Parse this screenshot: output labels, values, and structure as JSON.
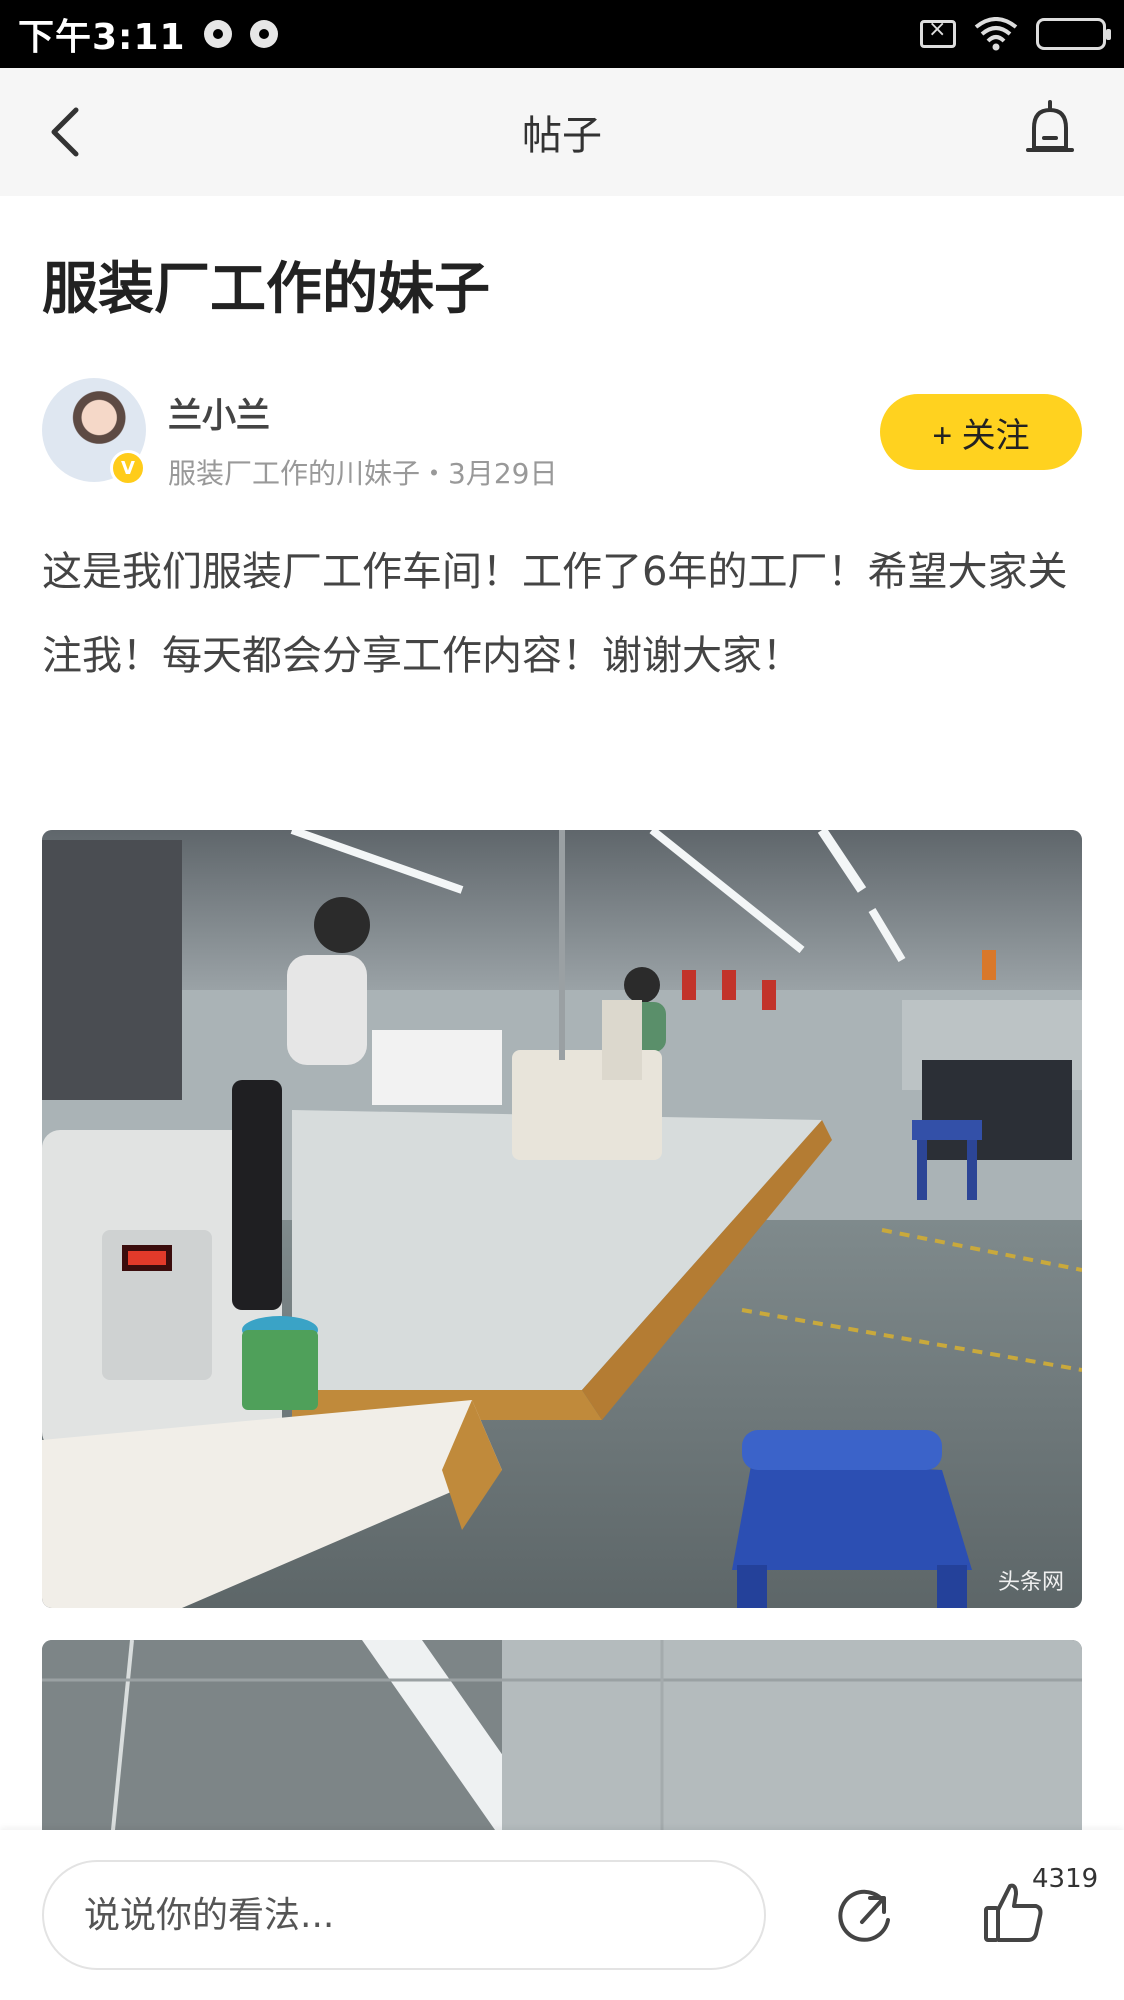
{
  "status_bar": {
    "time": "下午3:11"
  },
  "nav": {
    "title": "帖子"
  },
  "post": {
    "title": "服装厂工作的妹子",
    "author": {
      "name": "兰小兰",
      "verified_badge": "V",
      "meta": "服装厂工作的川妹子・3月29日"
    },
    "follow_label": "+ 关注",
    "body": "这是我们服装厂工作车间！工作了6年的工厂！希望大家关注我！每天都会分享工作内容！谢谢大家！",
    "images": [
      {
        "watermark": "头条网"
      }
    ]
  },
  "bottom_bar": {
    "comment_placeholder": "说说你的看法...",
    "like_count": "4319"
  },
  "colors": {
    "accent": "#ffd21f",
    "status_bar_bg": "#000000",
    "nav_bg": "#f6f6f6"
  },
  "icons": [
    "back-arrow-icon",
    "alert-bell-icon",
    "share-icon",
    "thumbs-up-icon",
    "wifi-icon",
    "battery-icon",
    "sim-icon"
  ]
}
